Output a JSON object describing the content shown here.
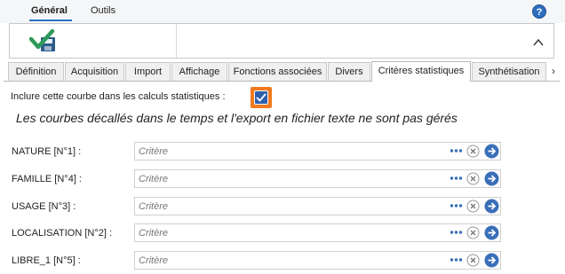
{
  "menu": {
    "tabs": [
      {
        "label": "Général",
        "active": true
      },
      {
        "label": "Outils",
        "active": false
      }
    ],
    "help_icon": "question-circle-icon",
    "help_glyph": "?"
  },
  "ribbon": {
    "app_icon": "check-save-icon",
    "collapse_icon": "chevron-up-icon"
  },
  "tabs": [
    {
      "label": "Définition",
      "active": false
    },
    {
      "label": "Acquisition",
      "active": false
    },
    {
      "label": "Import",
      "active": false
    },
    {
      "label": "Affichage",
      "active": false
    },
    {
      "label": "Fonctions associées",
      "active": false
    },
    {
      "label": "Divers",
      "active": false
    },
    {
      "label": "Critères statistiques",
      "active": true
    },
    {
      "label": "Synthétisation",
      "active": false
    }
  ],
  "tab_scroll_glyph": "›",
  "stats": {
    "include_label": "Inclure cette courbe dans les calculs statistiques :",
    "include_checked": true,
    "notice": "Les courbes décallés dans le temps et l'export en fichier texte ne sont pas gérés"
  },
  "criteria": [
    {
      "label": "NATURE [N°1] :",
      "placeholder": "Critère",
      "value": ""
    },
    {
      "label": "FAMILLE [N°4] :",
      "placeholder": "Critère",
      "value": ""
    },
    {
      "label": "USAGE [N°3] :",
      "placeholder": "Critère",
      "value": ""
    },
    {
      "label": "LOCALISATION [N°2] :",
      "placeholder": "Critère",
      "value": ""
    },
    {
      "label": "LIBRE_1 [N°5] :",
      "placeholder": "Critère",
      "value": ""
    }
  ],
  "colors": {
    "accent": "#2a70c8",
    "checkbox_highlight": "#f07a1f",
    "checkbox_fill": "#2e5fae",
    "go_button": "#3a6fb8"
  }
}
